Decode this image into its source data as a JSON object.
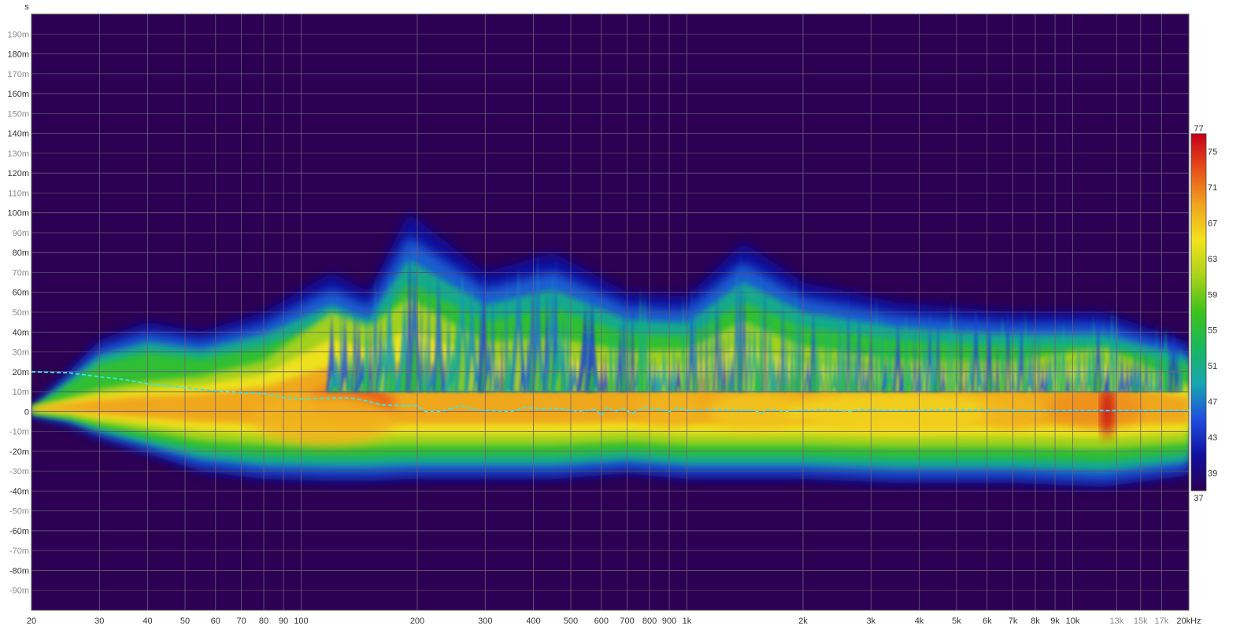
{
  "chart_data": {
    "type": "heatmap",
    "subtype": "spectrogram",
    "x_scale": "log",
    "y_unit_label": "s",
    "x_range": [
      20,
      20000
    ],
    "y_range": [
      -0.1,
      0.2
    ],
    "x_tick_labels": [
      {
        "value": 20,
        "label": "20"
      },
      {
        "value": 30,
        "label": "30"
      },
      {
        "value": 40,
        "label": "40"
      },
      {
        "value": 50,
        "label": "50"
      },
      {
        "value": 60,
        "label": "60"
      },
      {
        "value": 70,
        "label": "70"
      },
      {
        "value": 80,
        "label": "80"
      },
      {
        "value": 90,
        "label": "90"
      },
      {
        "value": 100,
        "label": "100"
      },
      {
        "value": 200,
        "label": "200"
      },
      {
        "value": 300,
        "label": "300"
      },
      {
        "value": 400,
        "label": "400"
      },
      {
        "value": 500,
        "label": "500"
      },
      {
        "value": 600,
        "label": "600"
      },
      {
        "value": 700,
        "label": "700"
      },
      {
        "value": 800,
        "label": "800"
      },
      {
        "value": 900,
        "label": "900"
      },
      {
        "value": 1000,
        "label": "1k"
      },
      {
        "value": 2000,
        "label": "2k"
      },
      {
        "value": 3000,
        "label": "3k"
      },
      {
        "value": 4000,
        "label": "4k"
      },
      {
        "value": 5000,
        "label": "5k"
      },
      {
        "value": 6000,
        "label": "6k"
      },
      {
        "value": 7000,
        "label": "7k"
      },
      {
        "value": 8000,
        "label": "8k"
      },
      {
        "value": 9000,
        "label": "9k"
      },
      {
        "value": 10000,
        "label": "10k"
      },
      {
        "value": 13000,
        "label": "13k",
        "muted": true
      },
      {
        "value": 15000,
        "label": "15k",
        "muted": true
      },
      {
        "value": 17000,
        "label": "17k",
        "muted": true
      },
      {
        "value": 20000,
        "label": "20kHz"
      }
    ],
    "y_tick_labels": [
      {
        "value": 0.19,
        "label": "190m",
        "muted": true
      },
      {
        "value": 0.18,
        "label": "180m"
      },
      {
        "value": 0.17,
        "label": "170m",
        "muted": true
      },
      {
        "value": 0.16,
        "label": "160m"
      },
      {
        "value": 0.15,
        "label": "150m",
        "muted": true
      },
      {
        "value": 0.14,
        "label": "140m"
      },
      {
        "value": 0.13,
        "label": "130m",
        "muted": true
      },
      {
        "value": 0.12,
        "label": "120m"
      },
      {
        "value": 0.11,
        "label": "110m",
        "muted": true
      },
      {
        "value": 0.1,
        "label": "100m"
      },
      {
        "value": 0.09,
        "label": "90m",
        "muted": true
      },
      {
        "value": 0.08,
        "label": "80m"
      },
      {
        "value": 0.07,
        "label": "70m",
        "muted": true
      },
      {
        "value": 0.06,
        "label": "60m"
      },
      {
        "value": 0.05,
        "label": "50m",
        "muted": true
      },
      {
        "value": 0.04,
        "label": "40m"
      },
      {
        "value": 0.03,
        "label": "30m",
        "muted": true
      },
      {
        "value": 0.02,
        "label": "20m"
      },
      {
        "value": 0.01,
        "label": "10m",
        "muted": true
      },
      {
        "value": 0,
        "label": "0"
      },
      {
        "value": -0.01,
        "label": "-10m",
        "muted": true
      },
      {
        "value": -0.02,
        "label": "-20m"
      },
      {
        "value": -0.03,
        "label": "-30m",
        "muted": true
      },
      {
        "value": -0.04,
        "label": "-40m"
      },
      {
        "value": -0.05,
        "label": "-50m",
        "muted": true
      },
      {
        "value": -0.06,
        "label": "-60m"
      },
      {
        "value": -0.07,
        "label": "-70m",
        "muted": true
      },
      {
        "value": -0.08,
        "label": "-80m"
      },
      {
        "value": -0.09,
        "label": "-90m",
        "muted": true
      }
    ],
    "colorbar": {
      "min": 37,
      "max": 77,
      "tick_labels": [
        "75",
        "71",
        "67",
        "63",
        "59",
        "55",
        "51",
        "47",
        "43",
        "39"
      ],
      "tick_values": [
        75,
        71,
        67,
        63,
        59,
        55,
        51,
        47,
        43,
        39
      ],
      "min_label": "37",
      "max_label": "77",
      "colors": [
        "#2c0052",
        "#1010a0",
        "#1f4ee0",
        "#17a6b0",
        "#19b85e",
        "#3cc21c",
        "#a8d21a",
        "#f2e21e",
        "#f0a51e",
        "#e8501b",
        "#c40018"
      ]
    },
    "peak_energy_line": {
      "color": "#3ee6e6",
      "style": "dashed",
      "points": [
        [
          20,
          0.02
        ],
        [
          25,
          0.0195
        ],
        [
          30,
          0.0175
        ],
        [
          35,
          0.016
        ],
        [
          40,
          0.014
        ],
        [
          50,
          0.012
        ],
        [
          55,
          0.011
        ],
        [
          70,
          0.0095
        ],
        [
          80,
          0.009
        ],
        [
          90,
          0.007
        ],
        [
          100,
          0.0065
        ],
        [
          120,
          0.0068
        ],
        [
          135,
          0.0068
        ],
        [
          150,
          0.005
        ],
        [
          160,
          0.0035
        ],
        [
          180,
          0.003
        ],
        [
          200,
          0.003
        ],
        [
          210,
          0.0
        ],
        [
          230,
          0.0
        ],
        [
          250,
          0.002
        ],
        [
          260,
          0.003
        ],
        [
          280,
          0.001
        ],
        [
          300,
          0.0005
        ],
        [
          350,
          0.0
        ],
        [
          380,
          0.002
        ],
        [
          420,
          0.0015
        ],
        [
          470,
          0.0015
        ],
        [
          520,
          0.0
        ],
        [
          580,
          0.001
        ],
        [
          600,
          -0.002
        ],
        [
          620,
          0.002
        ],
        [
          650,
          0.0
        ],
        [
          680,
          0.0015
        ],
        [
          720,
          -0.001
        ],
        [
          780,
          0.002
        ],
        [
          850,
          0.001
        ],
        [
          900,
          0.0
        ],
        [
          950,
          0.002
        ],
        [
          1000,
          0.0005
        ],
        [
          1200,
          0.001
        ],
        [
          1500,
          0.0005
        ],
        [
          1560,
          -0.001
        ],
        [
          1620,
          0.001
        ],
        [
          1800,
          0.0
        ],
        [
          1900,
          0.0005
        ],
        [
          2300,
          0.001
        ],
        [
          2650,
          0.0
        ],
        [
          2800,
          0.001
        ],
        [
          3500,
          0.0005
        ],
        [
          5000,
          0.001
        ],
        [
          8000,
          0.0005
        ],
        [
          13000,
          0.0005
        ],
        [
          20000,
          0.0005
        ]
      ]
    },
    "energy_profile": {
      "description_x": "frequency (Hz) vs decay boundaries in seconds",
      "points": [
        {
          "f": 20,
          "top": 0.001,
          "bottom": -0.002,
          "level": 40
        },
        {
          "f": 25,
          "top": 0.02,
          "bottom": -0.006,
          "level": 48
        },
        {
          "f": 30,
          "top": 0.036,
          "bottom": -0.013,
          "level": 55
        },
        {
          "f": 40,
          "top": 0.045,
          "bottom": -0.021,
          "level": 59
        },
        {
          "f": 55,
          "top": 0.04,
          "bottom": -0.03,
          "level": 62
        },
        {
          "f": 80,
          "top": 0.05,
          "bottom": -0.034,
          "level": 64
        },
        {
          "f": 120,
          "top": 0.07,
          "bottom": -0.035,
          "level": 70
        },
        {
          "f": 150,
          "top": 0.06,
          "bottom": -0.035,
          "level": 70
        },
        {
          "f": 190,
          "top": 0.1,
          "bottom": -0.034,
          "level": 66
        },
        {
          "f": 300,
          "top": 0.07,
          "bottom": -0.034,
          "level": 64
        },
        {
          "f": 450,
          "top": 0.08,
          "bottom": -0.034,
          "level": 63
        },
        {
          "f": 700,
          "top": 0.06,
          "bottom": -0.031,
          "level": 64
        },
        {
          "f": 1000,
          "top": 0.058,
          "bottom": -0.034,
          "level": 65
        },
        {
          "f": 1400,
          "top": 0.085,
          "bottom": -0.034,
          "level": 65
        },
        {
          "f": 2000,
          "top": 0.065,
          "bottom": -0.034,
          "level": 64
        },
        {
          "f": 3500,
          "top": 0.055,
          "bottom": -0.036,
          "level": 63
        },
        {
          "f": 7000,
          "top": 0.05,
          "bottom": -0.036,
          "level": 64
        },
        {
          "f": 12000,
          "top": 0.05,
          "bottom": -0.038,
          "level": 68
        },
        {
          "f": 20000,
          "top": 0.035,
          "bottom": -0.032,
          "level": 60
        }
      ]
    }
  }
}
